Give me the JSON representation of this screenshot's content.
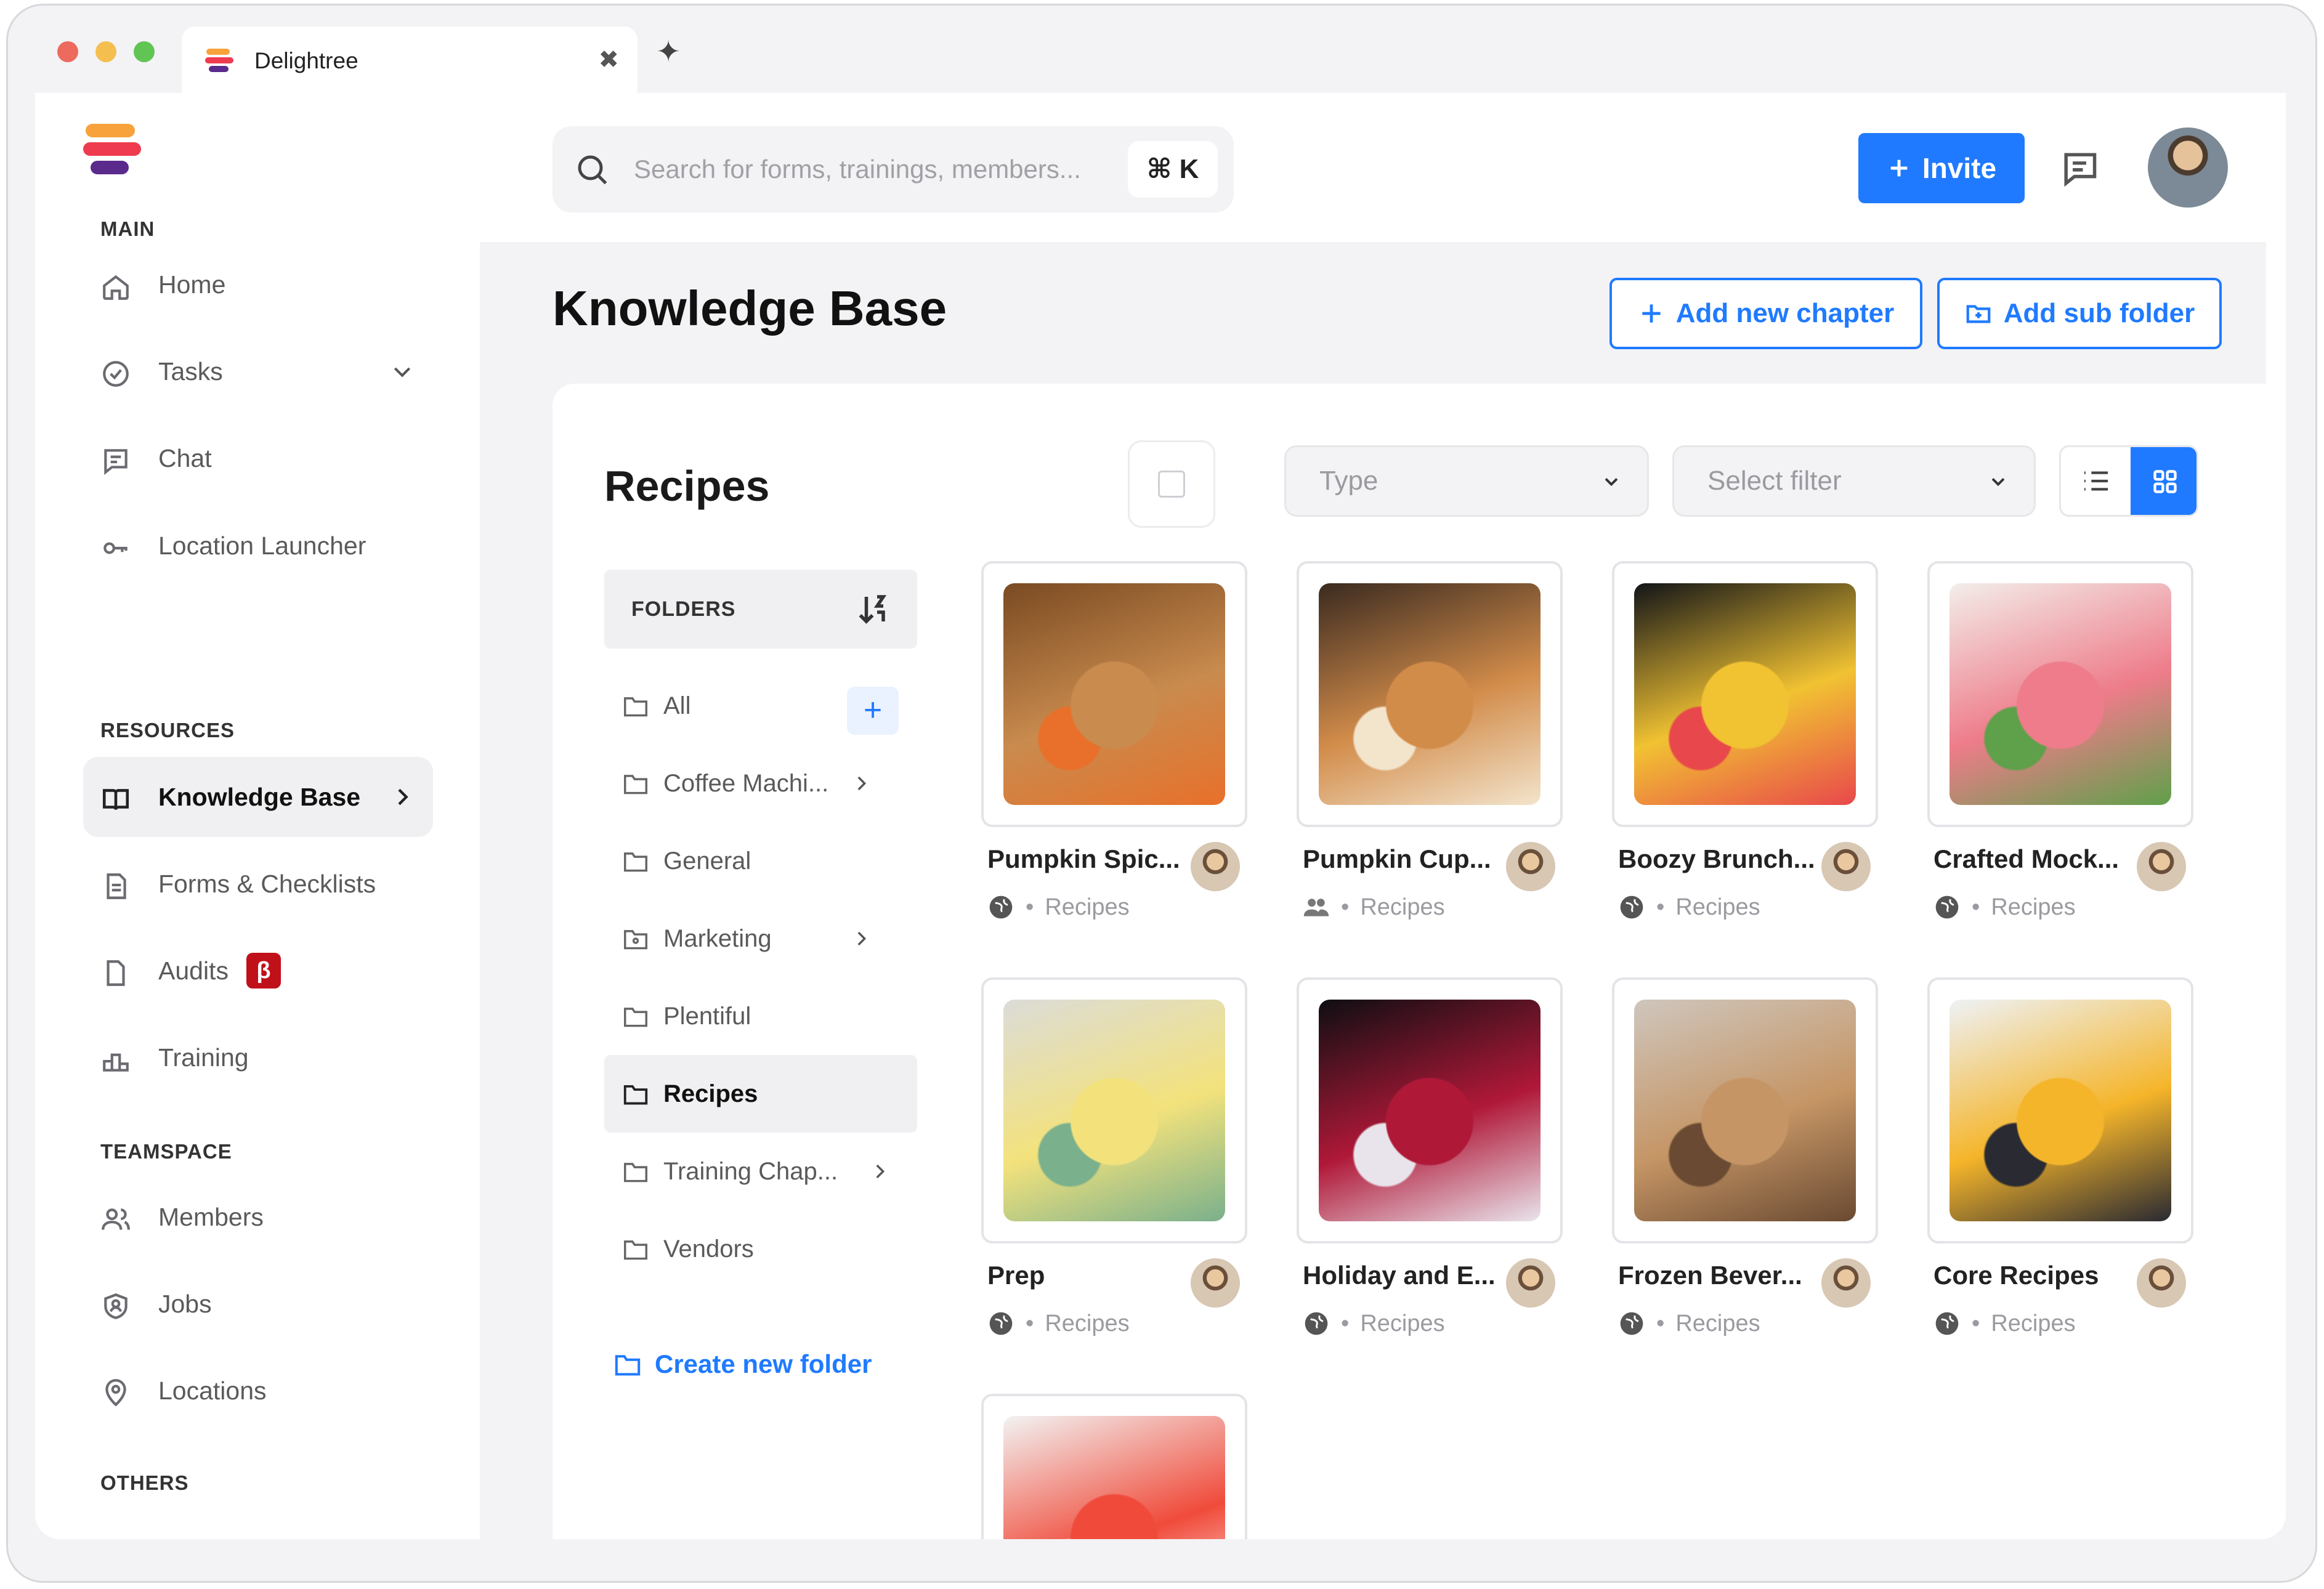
{
  "browser": {
    "tab_title": "Delightree",
    "close_glyph": "✖",
    "new_tab_glyph": "✦"
  },
  "search": {
    "placeholder": "Search for forms, trainings, members...",
    "shortcut": "⌘ K"
  },
  "header": {
    "invite_label": "Invite"
  },
  "sidebar": {
    "sections": {
      "main": "MAIN",
      "resources": "RESOURCES",
      "teamspace": "TEAMSPACE",
      "others": "OTHERS"
    },
    "items": {
      "home": "Home",
      "tasks": "Tasks",
      "chat": "Chat",
      "location_launcher": "Location Launcher",
      "knowledge_base": "Knowledge Base",
      "forms": "Forms & Checklists",
      "audits": "Audits",
      "audits_badge": "β",
      "training": "Training",
      "members": "Members",
      "jobs": "Jobs",
      "locations": "Locations"
    }
  },
  "page": {
    "title": "Knowledge Base",
    "add_chapter": "Add new chapter",
    "add_subfolder": "Add sub folder"
  },
  "panel": {
    "title": "Recipes",
    "type_placeholder": "Type",
    "filter_placeholder": "Select filter"
  },
  "folders": {
    "header": "FOLDERS",
    "items": [
      "All",
      "Coffee Machi...",
      "General",
      "Marketing",
      "Plentiful",
      "Recipes",
      "Training Chap...",
      "Vendors"
    ],
    "active": "Recipes",
    "create_label": "Create new folder"
  },
  "cards": [
    {
      "title": "Pumpkin Spic...",
      "category": "Recipes",
      "visibility": "globe-icon",
      "colors": [
        "#7a4a22",
        "#c98b4e",
        "#e8702a"
      ]
    },
    {
      "title": "Pumpkin Cup...",
      "category": "Recipes",
      "visibility": "users-icon",
      "colors": [
        "#3a2a20",
        "#d28c4a",
        "#f3e4cc"
      ]
    },
    {
      "title": "Boozy Brunch...",
      "category": "Recipes",
      "visibility": "globe-icon",
      "colors": [
        "#121418",
        "#f1c232",
        "#e8484b"
      ]
    },
    {
      "title": "Crafted Mock...",
      "category": "Recipes",
      "visibility": "globe-icon",
      "colors": [
        "#f3eeea",
        "#ee7c8a",
        "#5fa04a"
      ]
    },
    {
      "title": "Prep",
      "category": "Recipes",
      "visibility": "globe-icon",
      "colors": [
        "#dcdcd8",
        "#f3e27c",
        "#7ab08c"
      ]
    },
    {
      "title": "Holiday and E...",
      "category": "Recipes",
      "visibility": "globe-icon",
      "colors": [
        "#0e0e12",
        "#b01838",
        "#e9e4ec"
      ]
    },
    {
      "title": "Frozen Bever...",
      "category": "Recipes",
      "visibility": "globe-icon",
      "colors": [
        "#cfc6bd",
        "#c59565",
        "#6a4a32"
      ]
    },
    {
      "title": "Core Recipes",
      "category": "Recipes",
      "visibility": "globe-icon",
      "colors": [
        "#eef2f6",
        "#f5b52a",
        "#2a2a32"
      ]
    },
    {
      "title": "",
      "category": "",
      "visibility": "",
      "colors": [
        "#f3f3f3",
        "#f04b3a",
        "#ffffff"
      ]
    }
  ],
  "colors": {
    "accent": "#1f7aff",
    "beta": "#c0111a"
  }
}
